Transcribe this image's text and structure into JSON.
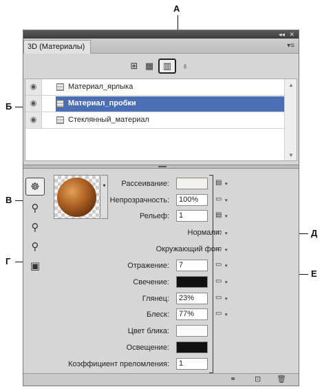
{
  "callouts": {
    "a": "А",
    "b": "Б",
    "v": "В",
    "g": "Г",
    "d": "Д",
    "e": "Е"
  },
  "panel": {
    "title_tab": "3D (Материалы)",
    "collapse_icon": "double-arrow-icon",
    "close_icon": "close-icon",
    "menu_icon": "panel-menu-icon"
  },
  "filter_icons": [
    "scene-icon",
    "mesh-icon",
    "materials-icon",
    "light-icon"
  ],
  "materials": [
    {
      "label": "Материал_ярлыка",
      "selected": false
    },
    {
      "label": "Материал_пробки",
      "selected": true
    },
    {
      "label": "Стеклянный_материал",
      "selected": false
    }
  ],
  "tools": [
    "material-select-icon",
    "material-drop-icon",
    "material-dropper-icon",
    "material-rotate-icon",
    "material-load-icon"
  ],
  "properties": {
    "diffuse": {
      "label": "Рассеивание:",
      "value": ""
    },
    "opacity": {
      "label": "Непрозрачность:",
      "value": "100%"
    },
    "bump": {
      "label": "Рельеф:",
      "value": "1"
    },
    "normal": {
      "label": "Нормали:"
    },
    "environment": {
      "label": "Окружающий фон:"
    },
    "reflection": {
      "label": "Отражение:",
      "value": "7"
    },
    "illumination": {
      "label": "Свечение:",
      "color": "#111111"
    },
    "gloss": {
      "label": "Глянец:",
      "value": "23%"
    },
    "shine": {
      "label": "Блеск:",
      "value": "77%"
    },
    "specular": {
      "label": "Цвет блика:",
      "color": "#fbfbfb"
    },
    "ambient": {
      "label": "Освещение:",
      "color": "#111111"
    },
    "refraction": {
      "label": "Коэффициент преломления:",
      "value": "1"
    }
  },
  "bottom_icons": [
    "render-icon",
    "new-icon",
    "delete-icon"
  ],
  "colors": {
    "selection": "#4a6fb5",
    "sphere": "#b86a2a"
  }
}
